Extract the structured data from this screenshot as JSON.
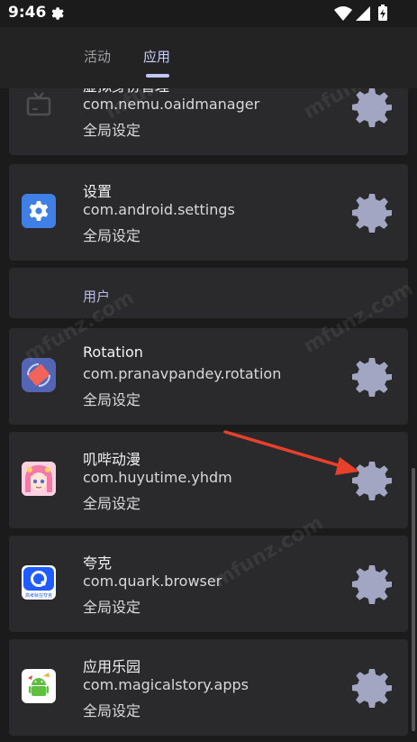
{
  "status_bar": {
    "time": "9:46"
  },
  "tabs": {
    "activity": "活动",
    "apps": "应用"
  },
  "section": {
    "users": "用户"
  },
  "watermark": "mfunz.com",
  "apps": [
    {
      "name": "虚拟身份管理",
      "package": "com.nemu.oaidmanager",
      "setting": "全局设定",
      "icon": "tv-icon"
    },
    {
      "name": "设置",
      "package": "com.android.settings",
      "setting": "全局设定",
      "icon": "settings-app-icon"
    },
    {
      "name": "Rotation",
      "package": "com.pranavpandey.rotation",
      "setting": "全局设定",
      "icon": "rotation-app-icon"
    },
    {
      "name": "叽哔动漫",
      "package": "com.huyutime.yhdm",
      "setting": "全局设定",
      "icon": "anime-girl-app-icon"
    },
    {
      "name": "夸克",
      "package": "com.quark.browser",
      "setting": "全局设定",
      "icon": "quark-app-icon",
      "icon_caption": "高考就在夸克"
    },
    {
      "name": "应用乐园",
      "package": "com.magicalstory.apps",
      "setting": "全局设定",
      "icon": "android-app-icon"
    }
  ],
  "colors": {
    "gear": "#a3a6c2",
    "card": "#2a2a2c",
    "accent": "#c2c7ff",
    "arrow": "#e8402b"
  }
}
